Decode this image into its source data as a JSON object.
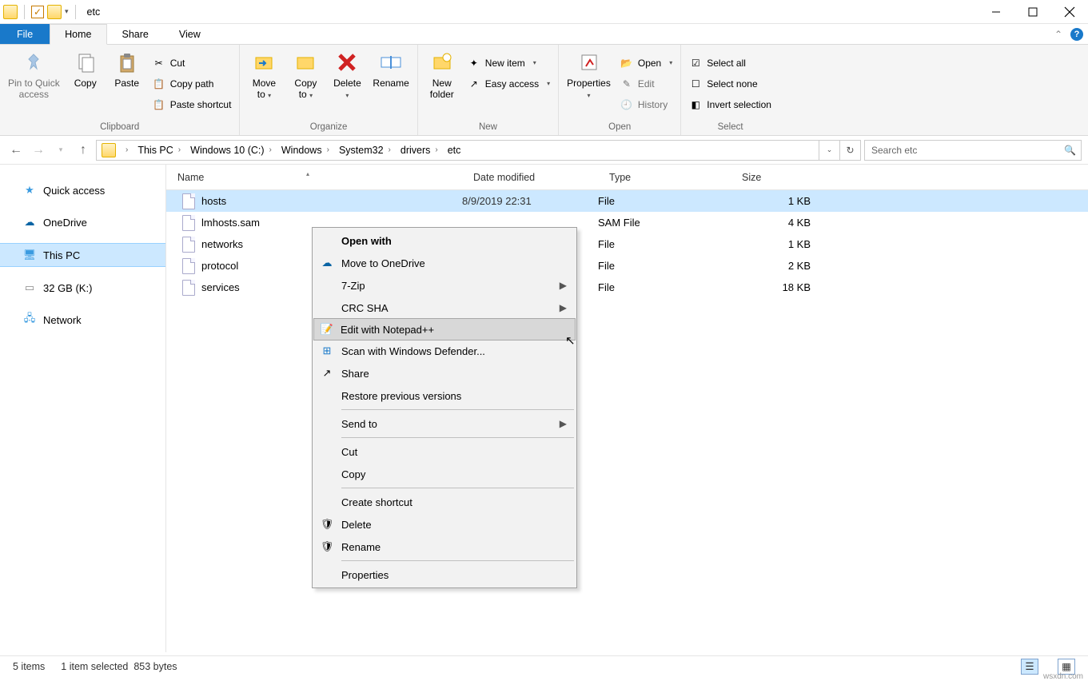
{
  "window": {
    "title": "etc"
  },
  "tabs": {
    "file": "File",
    "home": "Home",
    "share": "Share",
    "view": "View"
  },
  "ribbon": {
    "clipboard": {
      "label": "Clipboard",
      "pin": "Pin to Quick\naccess",
      "copy": "Copy",
      "paste": "Paste",
      "cut": "Cut",
      "copypath": "Copy path",
      "pasteshortcut": "Paste shortcut"
    },
    "organize": {
      "label": "Organize",
      "moveto": "Move\nto",
      "copyto": "Copy\nto",
      "delete": "Delete",
      "rename": "Rename"
    },
    "new": {
      "label": "New",
      "newfolder": "New\nfolder",
      "newitem": "New item",
      "easyaccess": "Easy access"
    },
    "open": {
      "label": "Open",
      "properties": "Properties",
      "open": "Open",
      "edit": "Edit",
      "history": "History"
    },
    "select": {
      "label": "Select",
      "selectall": "Select all",
      "selectnone": "Select none",
      "invert": "Invert selection"
    }
  },
  "breadcrumb": [
    "This PC",
    "Windows 10 (C:)",
    "Windows",
    "System32",
    "drivers",
    "etc"
  ],
  "search": {
    "placeholder": "Search etc"
  },
  "sidebar": {
    "items": [
      {
        "label": "Quick access"
      },
      {
        "label": "OneDrive"
      },
      {
        "label": "This PC"
      },
      {
        "label": "32 GB (K:)"
      },
      {
        "label": "Network"
      }
    ]
  },
  "columns": {
    "name": "Name",
    "date": "Date modified",
    "type": "Type",
    "size": "Size"
  },
  "files": [
    {
      "name": "hosts",
      "date": "8/9/2019 22:31",
      "type": "File",
      "size": "1 KB",
      "selected": true
    },
    {
      "name": "lmhosts.sam",
      "date": "",
      "type": "SAM File",
      "size": "4 KB"
    },
    {
      "name": "networks",
      "date": "",
      "type": "File",
      "size": "1 KB"
    },
    {
      "name": "protocol",
      "date": "",
      "type": "File",
      "size": "2 KB"
    },
    {
      "name": "services",
      "date": "",
      "type": "File",
      "size": "18 KB"
    }
  ],
  "context_menu": {
    "open_with": "Open with",
    "onedrive": "Move to OneDrive",
    "sevenzip": "7-Zip",
    "crc": "CRC SHA",
    "npp": "Edit with Notepad++",
    "defender": "Scan with Windows Defender...",
    "share": "Share",
    "restore": "Restore previous versions",
    "sendto": "Send to",
    "cut": "Cut",
    "copy": "Copy",
    "shortcut": "Create shortcut",
    "delete": "Delete",
    "rename": "Rename",
    "properties": "Properties"
  },
  "status": {
    "items": "5 items",
    "selected": "1 item selected",
    "bytes": "853 bytes"
  },
  "watermark": "wsxdn.com"
}
